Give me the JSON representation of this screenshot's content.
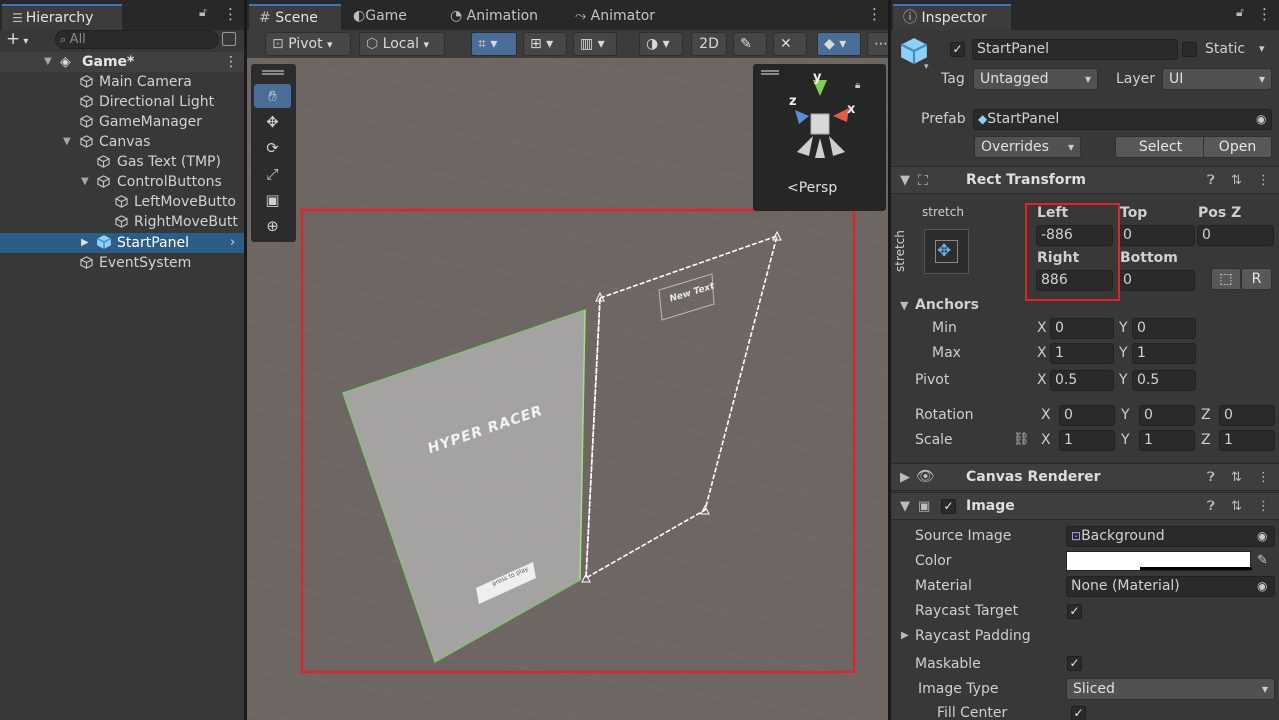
{
  "hierarchy": {
    "tab_label": "Hierarchy",
    "search_placeholder": "All",
    "add_label": "+",
    "scene_root": "Game*",
    "items": [
      {
        "label": "Main Camera"
      },
      {
        "label": "Directional Light"
      },
      {
        "label": "GameManager"
      },
      {
        "label": "Canvas"
      },
      {
        "label": "Gas Text (TMP)"
      },
      {
        "label": "ControlButtons"
      },
      {
        "label": "LeftMoveButto"
      },
      {
        "label": "RightMoveButt"
      },
      {
        "label": "StartPanel"
      },
      {
        "label": "EventSystem"
      }
    ]
  },
  "scene": {
    "tabs": [
      {
        "label": "Scene"
      },
      {
        "label": "Game"
      },
      {
        "label": "Animation"
      },
      {
        "label": "Animator"
      }
    ],
    "toolbar": {
      "pivot_label": "Pivot",
      "space_label": "Local",
      "mode_2d_label": "2D"
    },
    "gizmo": {
      "projection_label": "Persp",
      "axis_x": "x",
      "axis_y": "y",
      "axis_z": "z"
    },
    "canvas_texts": {
      "title": "HYPER RACER",
      "button_text": "press to play",
      "ghost_text": "New Text"
    },
    "highlight_color": "#e0242c"
  },
  "inspector": {
    "tab_label": "Inspector",
    "object_name": "StartPanel",
    "static_label": "Static",
    "tag_label": "Tag",
    "tag_value": "Untagged",
    "layer_label": "Layer",
    "layer_value": "UI",
    "prefab_label": "Prefab",
    "prefab_value": "StartPanel",
    "overrides_label": "Overrides",
    "select_label": "Select",
    "open_label": "Open",
    "rect_transform": {
      "title": "Rect Transform",
      "anchor_preset": "stretch",
      "left_label": "Left",
      "left_value": "-886",
      "top_label": "Top",
      "top_value": "0",
      "posz_label": "Pos Z",
      "posz_value": "0",
      "right_label": "Right",
      "right_value": "886",
      "bottom_label": "Bottom",
      "bottom_value": "0",
      "anchors_label": "Anchors",
      "min_label": "Min",
      "min_x": "0",
      "min_y": "0",
      "max_label": "Max",
      "max_x": "1",
      "max_y": "1",
      "pivot_label": "Pivot",
      "pivot_x": "0.5",
      "pivot_y": "0.5",
      "rotation_label": "Rotation",
      "rot_x": "0",
      "rot_y": "0",
      "rot_z": "0",
      "scale_label": "Scale",
      "scale_x": "1",
      "scale_y": "1",
      "scale_z": "1",
      "x_label": "X",
      "y_label": "Y",
      "z_label": "Z"
    },
    "canvas_renderer": {
      "title": "Canvas Renderer"
    },
    "image": {
      "title": "Image",
      "source_label": "Source Image",
      "source_value": "Background",
      "color_label": "Color",
      "material_label": "Material",
      "material_value": "None (Material)",
      "raycast_target_label": "Raycast Target",
      "raycast_padding_label": "Raycast Padding",
      "maskable_label": "Maskable",
      "image_type_label": "Image Type",
      "image_type_value": "Sliced",
      "fill_center_label": "Fill Center"
    }
  }
}
